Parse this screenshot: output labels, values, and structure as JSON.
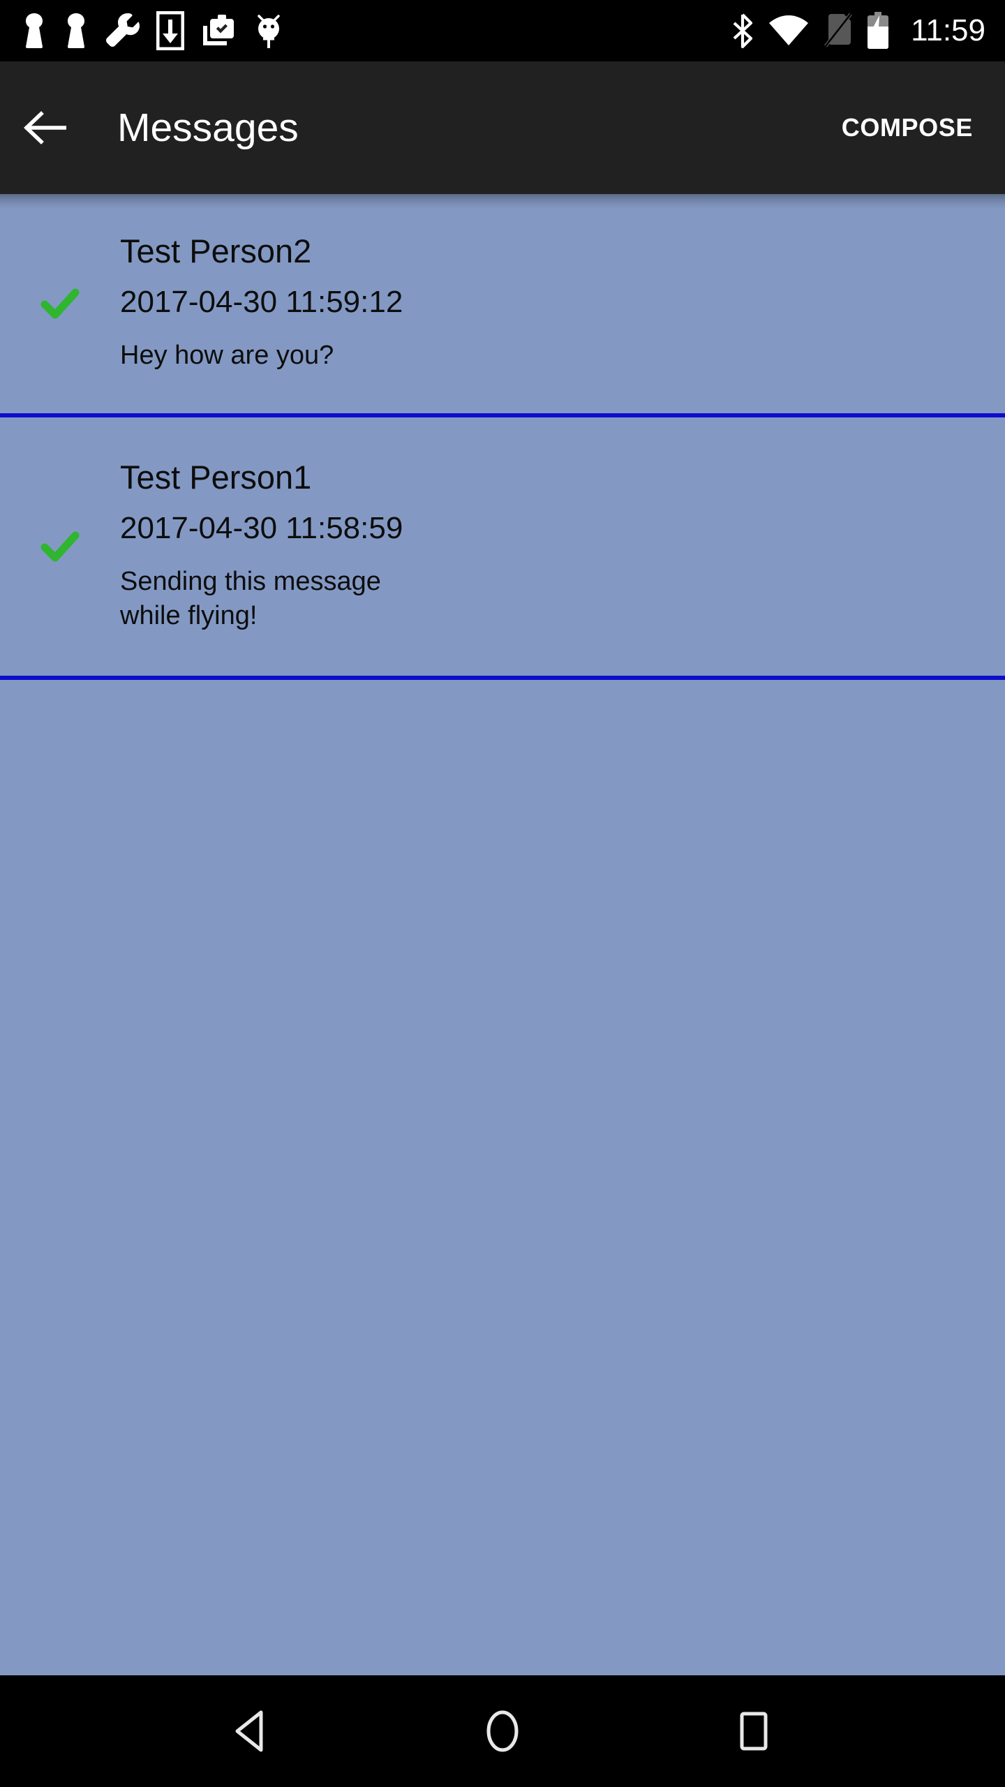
{
  "status_bar": {
    "left_icons": [
      {
        "name": "person-icon-1",
        "label": "person"
      },
      {
        "name": "person-icon-2",
        "label": "person"
      },
      {
        "name": "wrench-icon",
        "label": "developer tools"
      },
      {
        "name": "download-icon",
        "label": "download"
      },
      {
        "name": "work-profile-icon",
        "label": "work profile"
      },
      {
        "name": "android-debug-icon",
        "label": "adb"
      }
    ],
    "right_icons": [
      {
        "name": "bluetooth-icon",
        "label": "bluetooth"
      },
      {
        "name": "wifi-icon",
        "label": "wifi"
      },
      {
        "name": "no-sim-icon",
        "label": "no sim"
      },
      {
        "name": "battery-charging-icon",
        "label": "battery charging"
      }
    ],
    "clock": "11:59"
  },
  "app_bar": {
    "back_label": "Back",
    "title": "Messages",
    "compose_label": "COMPOSE"
  },
  "messages": [
    {
      "sender": "Test Person2",
      "timestamp": "2017-04-30 11:59:12",
      "body": "Hey how are you?",
      "status": "sent",
      "status_icon": "green-check-icon"
    },
    {
      "sender": "Test Person1",
      "timestamp": "2017-04-30 11:58:59",
      "body": "Sending this message\nwhile flying!",
      "status": "sent",
      "status_icon": "green-check-icon"
    }
  ],
  "nav_bar": {
    "back_label": "Back",
    "home_label": "Home",
    "recents_label": "Recent apps"
  },
  "colors": {
    "status_bar_bg": "#000000",
    "app_bar_bg": "#212121",
    "list_bg": "#8399c4",
    "divider": "#0d0dcc",
    "check_green": "#2fb52f",
    "text_primary": "#0d0d0d",
    "text_on_dark": "#ffffff"
  }
}
